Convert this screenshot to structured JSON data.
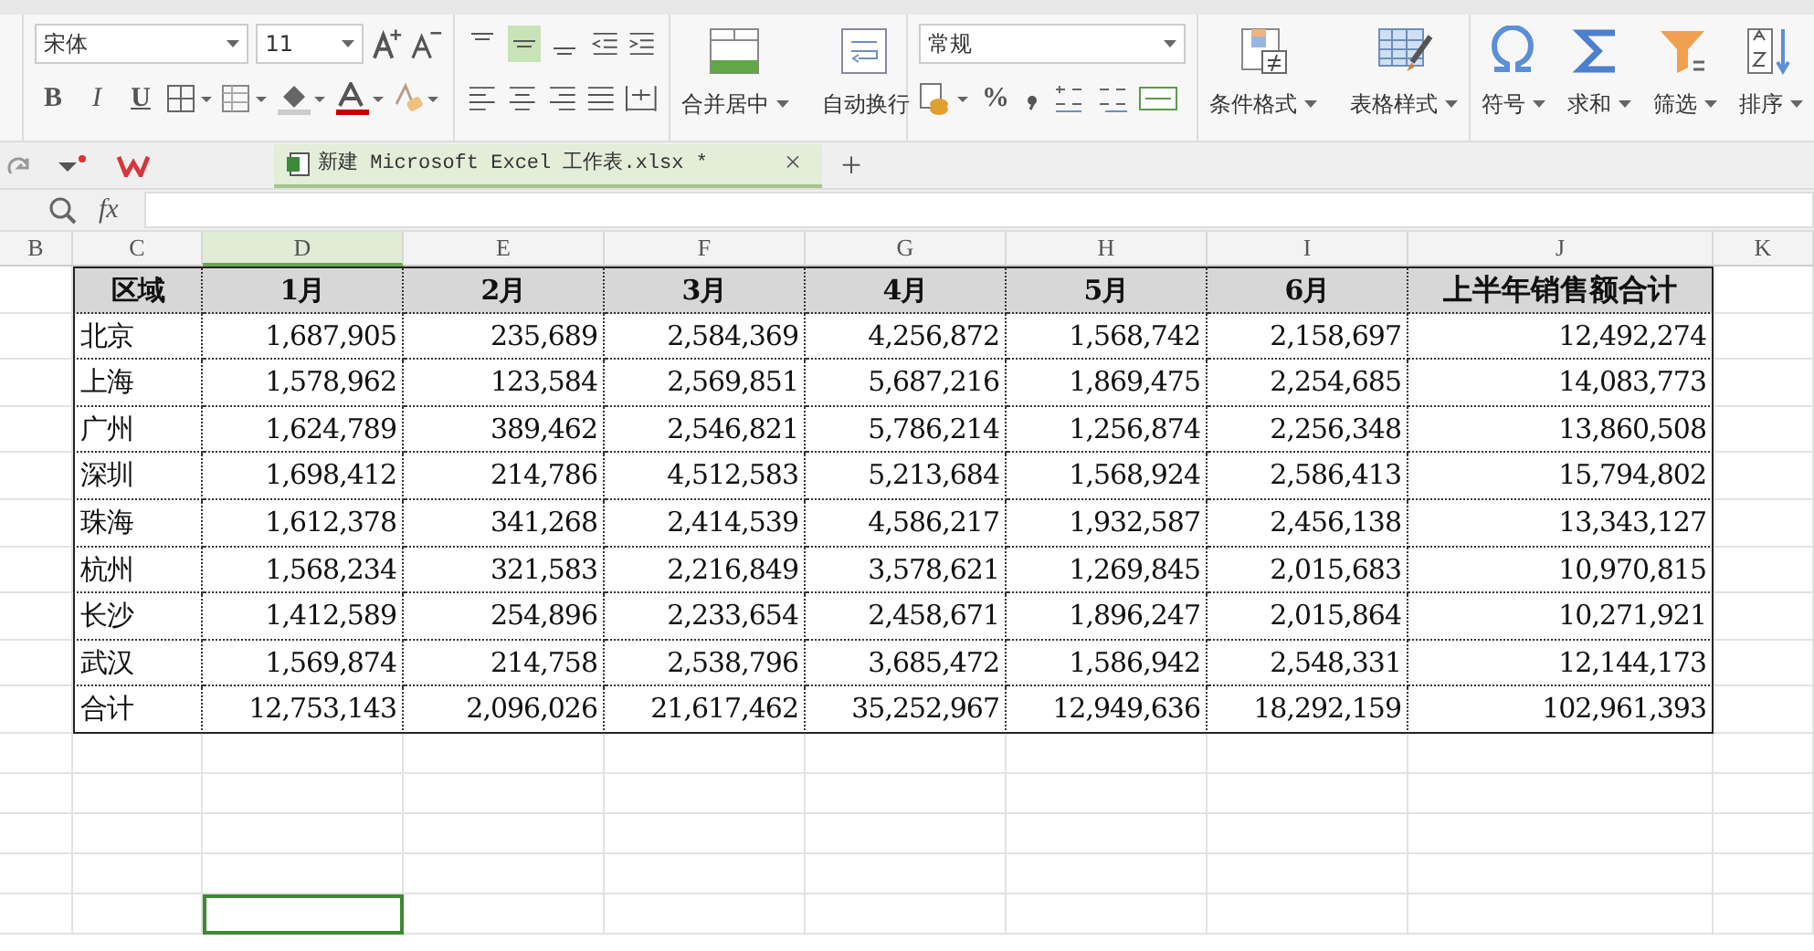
{
  "ribbon": {
    "font_name": "宋体",
    "font_size": "11",
    "number_format": "常规",
    "font_buttons": [
      {
        "text": "B",
        "kind": "bold"
      },
      {
        "text": "I",
        "kind": "italic"
      },
      {
        "text": "U",
        "kind": "underline"
      }
    ],
    "align_buttons": [
      {
        "kind": "top",
        "selected": false
      },
      {
        "kind": "middle",
        "selected": true
      },
      {
        "kind": "bottom",
        "selected": false
      }
    ],
    "percent": "%",
    "large_buttons": [
      {
        "label": "合并居中",
        "kind": "merge"
      },
      {
        "label": "自动换行",
        "kind": "wrap"
      },
      {
        "label": "条件格式",
        "kind": "conditional"
      },
      {
        "label": "表格样式",
        "kind": "tablestyle"
      },
      {
        "label": "符号",
        "kind": "symbol"
      },
      {
        "label": "求和",
        "kind": "sum"
      },
      {
        "label": "筛选",
        "kind": "filter"
      },
      {
        "label": "排序",
        "kind": "sort"
      }
    ]
  },
  "document_tab": {
    "title": "新建 Microsoft Excel 工作表.xlsx *",
    "close": "×",
    "add": "+"
  },
  "formula_bar": {
    "fx": "fx"
  },
  "column_headers": [
    {
      "label": "B",
      "selected": false
    },
    {
      "label": "C",
      "selected": false
    },
    {
      "label": "D",
      "selected": true
    },
    {
      "label": "E",
      "selected": false
    },
    {
      "label": "F",
      "selected": false
    },
    {
      "label": "G",
      "selected": false
    },
    {
      "label": "H",
      "selected": false
    },
    {
      "label": "I",
      "selected": false
    },
    {
      "label": "J",
      "selected": false
    },
    {
      "label": "K",
      "selected": false
    }
  ],
  "table": {
    "columns": [
      "区域",
      "1月",
      "2月",
      "3月",
      "4月",
      "5月",
      "6月",
      "上半年销售额合计"
    ],
    "rows": [
      [
        "北京",
        "1,687,905",
        "235,689",
        "2,584,369",
        "4,256,872",
        "1,568,742",
        "2,158,697",
        "12,492,274"
      ],
      [
        "上海",
        "1,578,962",
        "123,584",
        "2,569,851",
        "5,687,216",
        "1,869,475",
        "2,254,685",
        "14,083,773"
      ],
      [
        "广州",
        "1,624,789",
        "389,462",
        "2,546,821",
        "5,786,214",
        "1,256,874",
        "2,256,348",
        "13,860,508"
      ],
      [
        "深圳",
        "1,698,412",
        "214,786",
        "4,512,583",
        "5,213,684",
        "1,568,924",
        "2,586,413",
        "15,794,802"
      ],
      [
        "珠海",
        "1,612,378",
        "341,268",
        "2,414,539",
        "4,586,217",
        "1,932,587",
        "2,456,138",
        "13,343,127"
      ],
      [
        "杭州",
        "1,568,234",
        "321,583",
        "2,216,849",
        "3,578,621",
        "1,269,845",
        "2,015,683",
        "10,970,815"
      ],
      [
        "长沙",
        "1,412,589",
        "254,896",
        "2,233,654",
        "2,458,671",
        "1,896,247",
        "2,015,864",
        "10,271,921"
      ],
      [
        "武汉",
        "1,569,874",
        "214,758",
        "2,538,796",
        "3,685,472",
        "1,586,942",
        "2,548,331",
        "12,144,173"
      ],
      [
        "合计",
        "12,753,143",
        "2,096,026",
        "21,617,462",
        "35,252,967",
        "12,949,636",
        "18,292,159",
        "102,961,393"
      ]
    ]
  },
  "blank_rows": [
    {
      "selected": false
    },
    {
      "selected": false
    },
    {
      "selected": false
    },
    {
      "selected": false
    },
    {
      "selected": true
    }
  ]
}
